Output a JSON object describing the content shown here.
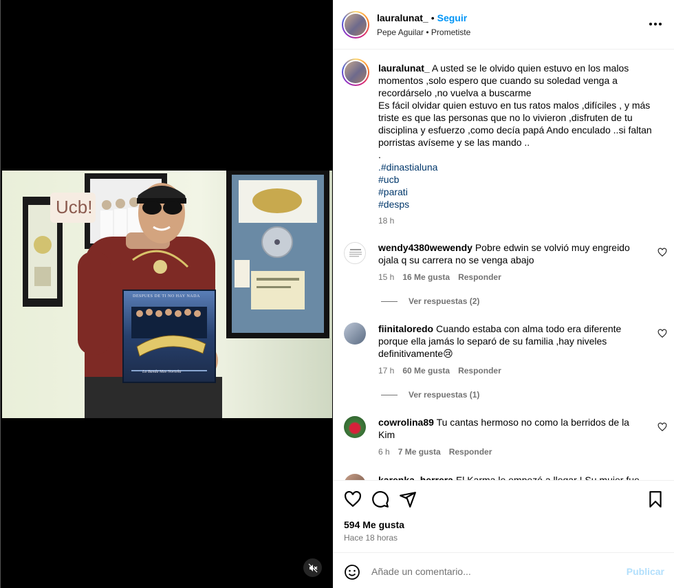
{
  "post": {
    "username": "lauralunat_",
    "follow_label": "Seguir",
    "dot": "•",
    "subtitle": "Pepe Aguilar • Prometiste",
    "photo_sticker": "Ucb!",
    "album_tagline": "Despues de ti no hay nada",
    "album_footer": "La Banda Mas Norteña"
  },
  "caption": {
    "username": "lauralunat_",
    "text_1": "A usted se le olvido quien estuvo en los malos momentos ,solo espero que cuando su soledad venga a recordárselo ,no vuelva a buscarme",
    "text_2": "Es fácil olvidar quien estuvo en tus ratos malos ,difíciles , y más triste es que las personas que no lo vivieron ,disfruten de tu disciplina y esfuerzo ,como decía papá Ando enculado ..si faltan porristas avíseme y se las mando ..",
    "text_3": ".",
    "hashtags": [
      ".#dinastialuna",
      "#ucb",
      "#parati",
      "#desps"
    ],
    "time": "18 h"
  },
  "comments": [
    {
      "username": "wendy4380wewendy",
      "text": "Pobre edwin se volvió muy engreido ojala q su carrera no se venga abajo",
      "time": "15 h",
      "likes": "16 Me gusta",
      "reply": "Responder",
      "replies": "Ver respuestas (2)"
    },
    {
      "username": "fiinitaloredo",
      "text": "Cuando estaba con alma todo era diferente porque ella jamás lo separó de su familia ,hay niveles definitivamente😢",
      "time": "17 h",
      "likes": "60 Me gusta",
      "reply": "Responder",
      "replies": "Ver respuestas (1)"
    },
    {
      "username": "cowrolina89",
      "text": "Tu cantas hermoso no como la berridos de la Kim",
      "time": "6 h",
      "likes": "7 Me gusta",
      "reply": "Responder"
    },
    {
      "username": "karenka_herrera",
      "text": "El Karma le empezó a llegar ! Su mujer fue"
    }
  ],
  "footer": {
    "likes": "594 Me gusta",
    "ago": "Hace 18 horas",
    "comment_placeholder": "Añade un comentario...",
    "publish_label": "Publicar"
  },
  "icons": [
    "heart-icon",
    "comment-icon",
    "share-icon",
    "bookmark-icon",
    "emoji-icon",
    "mute-icon",
    "more-options-icon"
  ],
  "colors": {
    "accent": "#0095f6",
    "hashtag": "#00376b",
    "muted": "#737373",
    "publish_disabled": "#b2dffc"
  }
}
